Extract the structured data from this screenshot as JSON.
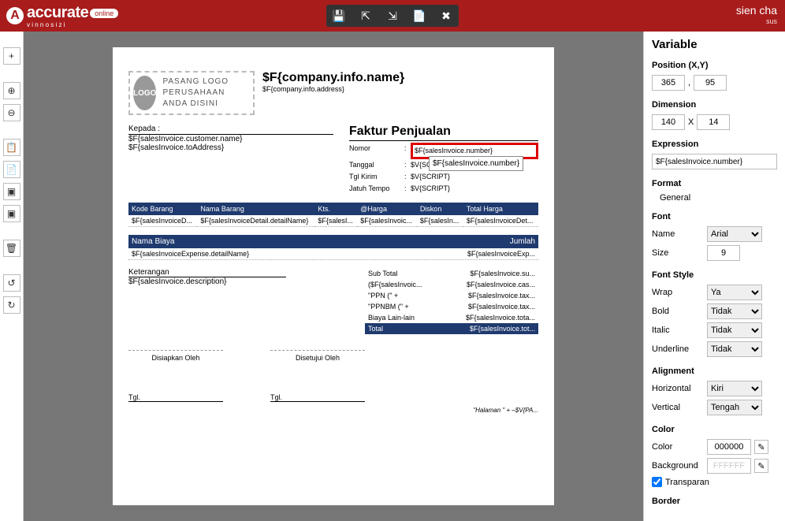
{
  "header": {
    "brand": "accurate",
    "brand_badge": "online",
    "user_name": "sien cha",
    "user_sub": "sus"
  },
  "left_tools": [
    "+",
    "⊕",
    "⊖",
    "📋",
    "📄",
    "▣",
    "▣",
    "🗑",
    "↺",
    "↻"
  ],
  "top_toolbar": [
    "💾",
    "⇱",
    "⇲",
    "📄",
    "✖"
  ],
  "document": {
    "company_name": "$F{company.info.name}",
    "company_address": "$F{company.info.address}",
    "logo_text": "PASANG LOGO PERUSAHAAN ANDA DISINI",
    "logo_label": "LOGO",
    "kepada_label": "Kepada :",
    "customer_name": "$F{salesInvoice.customer.name}",
    "to_address": "$F{salesInvoice.toAddress}",
    "doc_title": "Faktur Penjualan",
    "fields": {
      "nomor_label": "Nomor",
      "nomor_value": "$F{salesInvoice.number}",
      "nomor_tooltip": "$F{salesInvoice.number}",
      "tanggal_label": "Tanggal",
      "tanggal_value": "$V{SCRIPT}",
      "tgl_kirim_label": "Tgl Kirim",
      "tgl_kirim_value": "$V{SCRIPT}",
      "jatuh_tempo_label": "Jatuh Tempo",
      "jatuh_tempo_value": "$V{SCRIPT}"
    },
    "columns": {
      "kode": "Kode Barang",
      "nama": "Nama Barang",
      "kts": "Kts.",
      "harga": "@Harga",
      "diskon": "Diskon",
      "total": "Total Harga"
    },
    "row_sample": {
      "kode": "$F{salesInvoiceD...",
      "nama": "$F{salesInvoiceDetail.detailName}",
      "kts": "$F{salesI...",
      "harga": "$F{salesInvoic...",
      "diskon": "$F{salesIn...",
      "total": "$F{salesInvoiceDet..."
    },
    "expense_head_left": "Nama Biaya",
    "expense_head_right": "Jumlah",
    "expense_row_left": "$F{salesInvoiceExpense.detailName}",
    "expense_row_right": "$F{salesInvoiceExp...",
    "keterangan_label": "Keterangan",
    "keterangan_value": "$F{salesInvoice.description}",
    "subtotals": [
      {
        "l": "Sub Total",
        "v": "$F{salesInvoice.su..."
      },
      {
        "l": "($F{salesInvoic...",
        "v": "$F{salesInvoice.cas..."
      },
      {
        "l": "\"PPN (\" +",
        "v": "$F{salesInvoice.tax..."
      },
      {
        "l": "\"PPNBM (\" +",
        "v": "$F{salesInvoice.tax..."
      },
      {
        "l": "Biaya Lain-lain",
        "v": "$F{salesInvoice.tota..."
      }
    ],
    "total_label": "Total",
    "total_value": "$F{salesInvoice.tot...",
    "sign1": "Disiapkan Oleh",
    "sign2": "Disetujui Oleh",
    "tgl_label": "Tgl.",
    "footer_note": "\"Halaman \" + –$V{PA..."
  },
  "panel": {
    "title": "Variable",
    "position_label": "Position (X,Y)",
    "pos_x": "365",
    "pos_y": "95",
    "dimension_label": "Dimension",
    "dim_w": "140",
    "dim_h": "14",
    "dim_sep": "X",
    "pos_sep": ",",
    "expression_label": "Expression",
    "expression_value": "$F{salesInvoice.number}",
    "format_label": "Format",
    "format_value": "General",
    "font_label": "Font",
    "font_name_label": "Name",
    "font_name_value": "Arial",
    "font_size_label": "Size",
    "font_size_value": "9",
    "font_style_label": "Font Style",
    "wrap_label": "Wrap",
    "wrap_value": "Ya",
    "bold_label": "Bold",
    "bold_value": "Tidak",
    "italic_label": "Italic",
    "italic_value": "Tidak",
    "underline_label": "Underline",
    "underline_value": "Tidak",
    "alignment_label": "Alignment",
    "h_label": "Horizontal",
    "h_value": "Kiri",
    "v_label": "Vertical",
    "v_value": "Tengah",
    "color_label": "Color",
    "color_field_label": "Color",
    "color_value": "000000",
    "bg_label": "Background",
    "bg_value": "FFFFFF",
    "transparent_label": "Transparan",
    "border_label": "Border"
  }
}
